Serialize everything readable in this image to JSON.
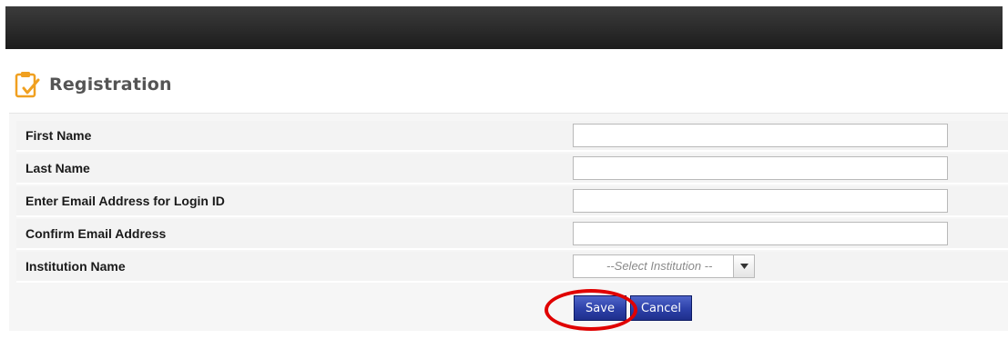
{
  "heading": {
    "title": "Registration",
    "icon": "clipboard-check-icon"
  },
  "form": {
    "fields": [
      {
        "label": "First Name",
        "value": "",
        "type": "text"
      },
      {
        "label": "Last Name",
        "value": "",
        "type": "text"
      },
      {
        "label": "Enter Email Address for Login ID",
        "value": "",
        "type": "text"
      },
      {
        "label": "Confirm Email Address",
        "value": "",
        "type": "text"
      },
      {
        "label": "Institution Name",
        "value": "--Select Institution --",
        "type": "select"
      }
    ],
    "save_label": "Save",
    "cancel_label": "Cancel"
  },
  "colors": {
    "topbar": "#2c2c2c",
    "button": "#2c40a8",
    "highlight": "#e00000",
    "icon": "#f0a020"
  }
}
